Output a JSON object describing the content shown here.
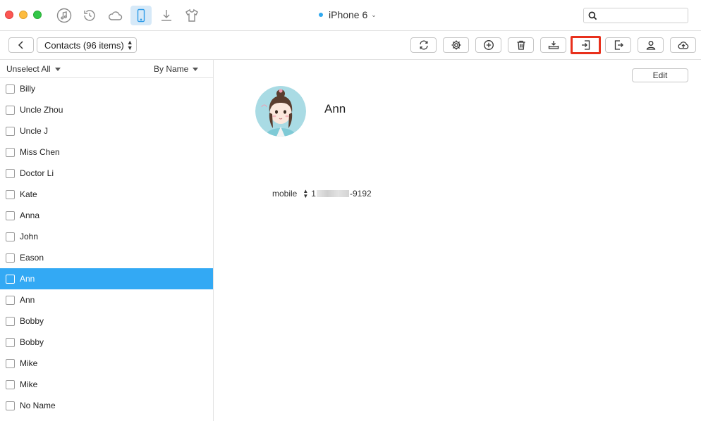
{
  "titlebar": {
    "device_name": "iPhone 6",
    "device_dot_color": "#2fa8ef",
    "icons": [
      "music-icon",
      "restore-icon",
      "cloud-icon",
      "phone-icon",
      "download-icon",
      "tshirt-icon"
    ],
    "search_placeholder": ""
  },
  "toolbar": {
    "contacts_label": "Contacts (96 items)",
    "buttons": [
      "refresh-icon",
      "settings-icon",
      "add-icon",
      "delete-icon",
      "to-device-icon",
      "import-icon",
      "export-icon",
      "contact-icon",
      "upload-cloud-icon"
    ],
    "highlight_color": "#e8301c"
  },
  "sidebar": {
    "unselect_label": "Unselect All",
    "sort_label": "By Name",
    "contacts": [
      {
        "name": "Billy",
        "selected": false
      },
      {
        "name": "Uncle Zhou",
        "selected": false
      },
      {
        "name": "Uncle J",
        "selected": false
      },
      {
        "name": "Miss Chen",
        "selected": false
      },
      {
        "name": "Doctor Li",
        "selected": false
      },
      {
        "name": "Kate",
        "selected": false
      },
      {
        "name": "Anna",
        "selected": false
      },
      {
        "name": "John",
        "selected": false
      },
      {
        "name": "Eason",
        "selected": false
      },
      {
        "name": "Ann",
        "selected": true
      },
      {
        "name": "Ann",
        "selected": false
      },
      {
        "name": "Bobby",
        "selected": false
      },
      {
        "name": "Bobby",
        "selected": false
      },
      {
        "name": "Mike",
        "selected": false
      },
      {
        "name": "Mike",
        "selected": false
      },
      {
        "name": "No Name",
        "selected": false
      }
    ],
    "selected_color": "#33a9f4"
  },
  "detail": {
    "edit_label": "Edit",
    "name": "Ann",
    "field_label": "mobile",
    "phone_prefix": "1",
    "phone_suffix": "-9192"
  }
}
